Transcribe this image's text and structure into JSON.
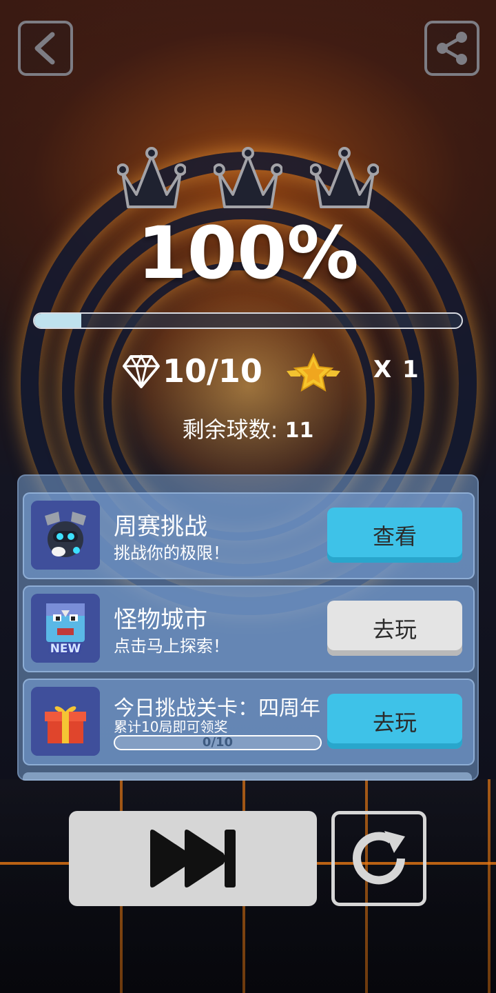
{
  "result": {
    "percent_label": "100%",
    "progress_fraction": 0.11,
    "gems_label": "10/10",
    "star_multiplier_label": "X 1",
    "balls_label": "剩余球数:",
    "balls_value": "11"
  },
  "crowns": {
    "count": 3
  },
  "cards": [
    {
      "title": "周赛挑战",
      "subtitle": "挑战你的极限！",
      "button_label": "查看",
      "button_style": "blue",
      "icon": "robot-icon"
    },
    {
      "title": "怪物城市",
      "subtitle": "点击马上探索！",
      "button_label": "去玩",
      "button_style": "gray",
      "icon": "monster-icon",
      "badge_label": "NEW"
    },
    {
      "title": "今日挑战关卡：四周年",
      "subtitle": "累计10局即可领奖",
      "progress_label": "0/10",
      "progress_fraction": 0,
      "button_label": "去玩",
      "button_style": "blue",
      "icon": "gift-icon"
    }
  ],
  "colors": {
    "accent_blue": "#3ec2e8",
    "button_gray": "#e4e4e4",
    "panel": "#7ea0d2",
    "floor_glow": "#e67814"
  },
  "icons": {
    "back": "back-arrow-icon",
    "share": "share-icon",
    "gem": "diamond-icon",
    "star": "winged-star-icon",
    "skip": "fast-forward-icon",
    "retry": "restart-icon"
  }
}
